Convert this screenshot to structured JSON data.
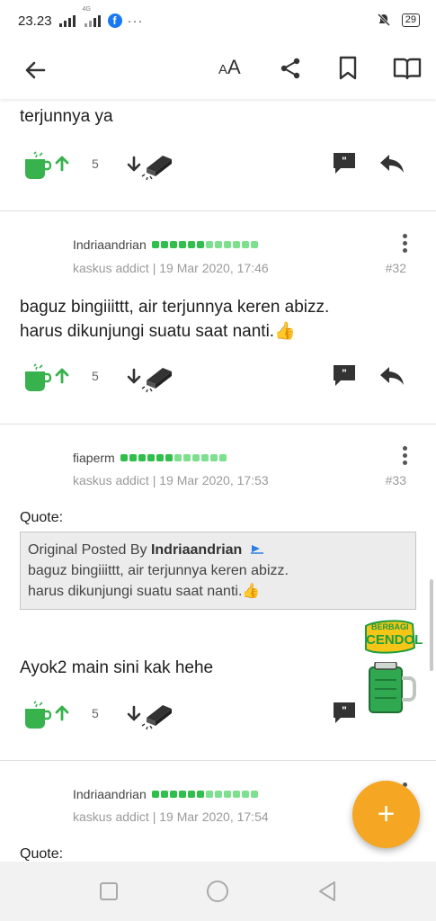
{
  "status": {
    "time": "23.23",
    "network_label": "4G",
    "battery": "29",
    "more": "···"
  },
  "toolbar": {
    "font_size_label": "AA",
    "font_small": "A",
    "font_large": "A"
  },
  "posts": [
    {
      "tail_text": "terjunnya ya",
      "votes": "5"
    },
    {
      "username": "Indriaandrian",
      "meta": "kaskus addict | 19 Mar 2020, 17:46",
      "number": "#32",
      "text_line1": "baguz bingiiittt, air terjunnya keren abizz.",
      "text_line2": "harus dikunjungi suatu saat nanti.👍",
      "votes": "5"
    },
    {
      "username": "fiaperm",
      "meta": "kaskus addict | 19 Mar 2020, 17:53",
      "number": "#33",
      "quote_label": "Quote:",
      "quote_prefix": "Original Posted By ",
      "quote_author": "Indriaandrian",
      "quote_line1": "baguz bingiiittt, air terjunnya keren abizz.",
      "quote_line2": "harus dikunjungi suatu saat nanti.👍",
      "text": "Ayok2 main sini kak hehe",
      "votes": "5",
      "cendol_sticker_line1": "BERBAGI",
      "cendol_sticker_line2": "CENDOL"
    },
    {
      "username": "Indriaandrian",
      "meta": "kaskus addict | 19 Mar 2020, 17:54",
      "quote_label": "Quote:"
    }
  ],
  "fab": {
    "label": "+"
  },
  "colors": {
    "accent_green": "#37b24d",
    "fab_orange": "#f5a623",
    "rep_green": "#2fbf4a",
    "rep_light": "#7de08e",
    "link_blue": "#2a7de1"
  }
}
